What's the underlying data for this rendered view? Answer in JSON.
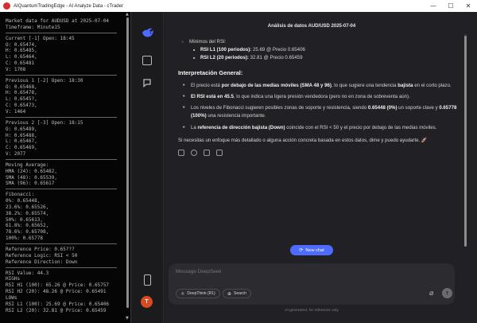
{
  "window": {
    "title": "AIQuantumTradingEdge - AI Analyze Data - cTrader",
    "controls": [
      "—",
      "☐",
      "✕"
    ]
  },
  "market_panel": {
    "lines": [
      "Market data for AUDUSD at 2025-07-04",
      "Timeframe: Minute15",
      "---",
      "Current [-1] Open: 18:45",
      "O: 0.65474,",
      "H: 0.65485,",
      "L: 0.65464,",
      "C: 0.65481",
      "V: 1708",
      "---",
      "Previous 1 [-2] Open: 18:30",
      "O: 0.65468,",
      "H: 0.65478,",
      "L: 0.6545?,",
      "C: 0.65473,",
      "V: 1464",
      "---",
      "Previous 2 [-3] Open: 18:15",
      "O: 0.65489,",
      "H: 0.65488,",
      "L: 0.65467,",
      "C: 0.65469,",
      "V: 2077",
      "---",
      "Moving Average:",
      "HMA (24): 0.65482,",
      "SMA (48): 0.65539,",
      "SMA (96): 0.65617",
      "---",
      "Fibonacci:",
      "0%: 0.65448,",
      "23.6%: 0.65526,",
      "38.2%: 0.65574,",
      "50%: 0.65613,",
      "61.8%: 0.65652,",
      "78.6%: 0.65708,",
      "100%: 0.65778",
      "---",
      "Reference Price: 0.65???",
      "Reference Logic: RSI < 50",
      "Reference Direction: Down",
      "---",
      "RSI Value: 44.3",
      "HIGHs",
      "RSI H1 (100): 65.26 @ Price: 0.65757",
      "RSI H2 (20): 48.26 @ Price: 0.65491",
      "LOWs",
      "RSI L1 (100): 25.69 @ Price: 0.65406",
      "RSI L2 (20): 32.81 @ Price: 0.65459"
    ]
  },
  "chat": {
    "header_title": "Análisis de datos AUD/USD 2025-07-04",
    "rsi_min_heading": "Mínimos del RSI:",
    "rsi_min_items": [
      {
        "label": "RSI L1 (100 periodos):",
        "value": " 25.69 @ Precio 0.65406"
      },
      {
        "label": "RSI L2 (20 periodos):",
        "value": " 32.81 @ Precio 0.65459"
      }
    ],
    "section_title": "Interpretación General:",
    "bullets": [
      {
        "pre": "El precio está ",
        "bold": "por debajo de las medias móviles (SMA 48 y 96)",
        "post": ", lo que sugiere una tendencia ",
        "bold2": "bajista",
        "post2": " en el corto plazo."
      },
      {
        "pre": "",
        "bold": "El RSI está en 45.5",
        "post": ", lo que indica una ligera presión vendedora (pero no en zona de sobreventa aún).",
        "bold2": "",
        "post2": ""
      },
      {
        "pre": "Los niveles de Fibonacci sugieren posibles zonas de soporte y resistencia, siendo ",
        "bold": "0.65448 (0%)",
        "post": " un soporte clave y ",
        "bold2": "0.65778 (100%)",
        "post2": " una resistencia importante."
      },
      {
        "pre": "La ",
        "bold": "referencia de dirección bajista (Down)",
        "post": " coincide con el RSI < 50 y el precio por debajo de las medias móviles.",
        "bold2": "",
        "post2": ""
      }
    ],
    "closing": "Si necesitas un enfoque más detallado o alguna acción concreta basada en estos datos, dime y puedo ayudarte. 🚀",
    "new_chat_label": "New chat",
    "composer_placeholder": "Message DeepSeek",
    "deepthink_label": "DeepThink (R1)",
    "search_label": "Search",
    "disclaimer": "AI-generated, for reference only"
  },
  "colors": {
    "accent": "#4d6bfe",
    "avatar": "#d94a1e",
    "app_icon": "#d62f2f"
  },
  "avatar_letter": "T"
}
